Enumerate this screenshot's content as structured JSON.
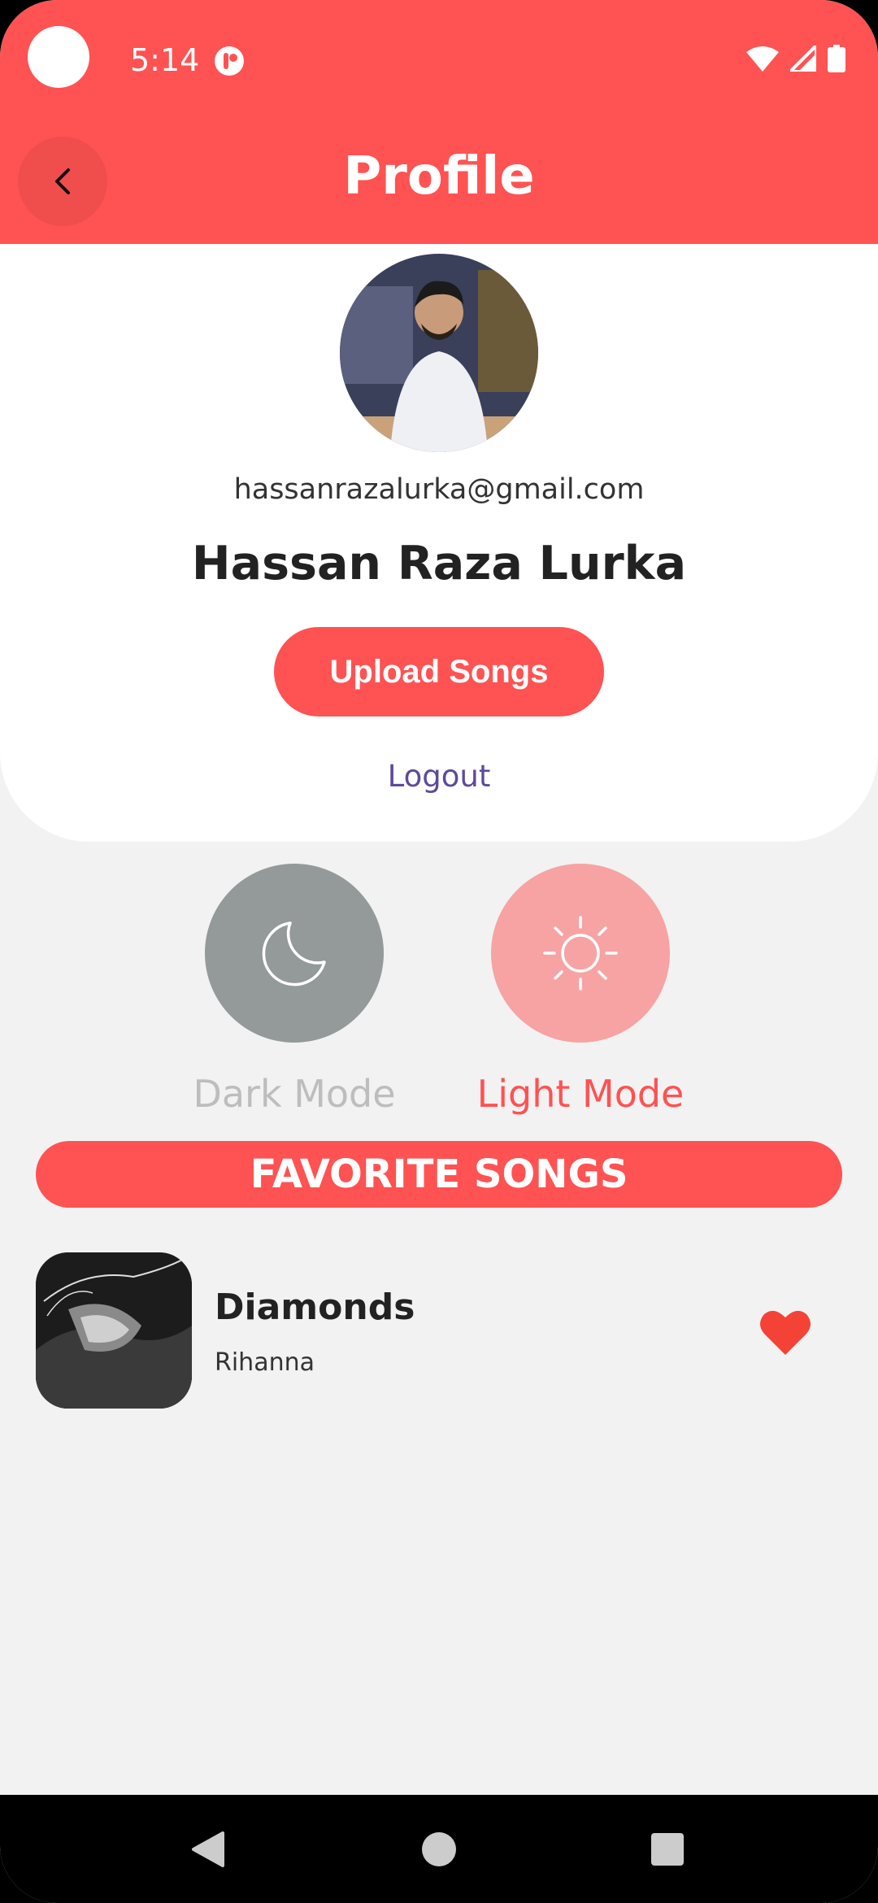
{
  "status_bar": {
    "time": "5:14"
  },
  "app_bar": {
    "title": "Profile",
    "back_icon": "chevron-left-icon"
  },
  "profile": {
    "email": "hassanrazalurka@gmail.com",
    "name": "Hassan Raza Lurka",
    "upload_label": "Upload Songs",
    "logout_label": "Logout"
  },
  "theme": {
    "dark_label": "Dark Mode",
    "light_label": "Light Mode",
    "dark_icon": "moon-icon",
    "light_icon": "sun-icon",
    "selected": "light"
  },
  "favorites": {
    "header": "FAVORITE SONGS",
    "songs": [
      {
        "title": "Diamonds",
        "artist": "Rihanna",
        "favorited": true
      }
    ]
  },
  "colors": {
    "accent": "#ff5252",
    "dark_mode_circle": "#949999",
    "light_mode_circle": "#f7a3a3",
    "logout_text": "#5e4a9a",
    "background": "#f2f2f2"
  }
}
